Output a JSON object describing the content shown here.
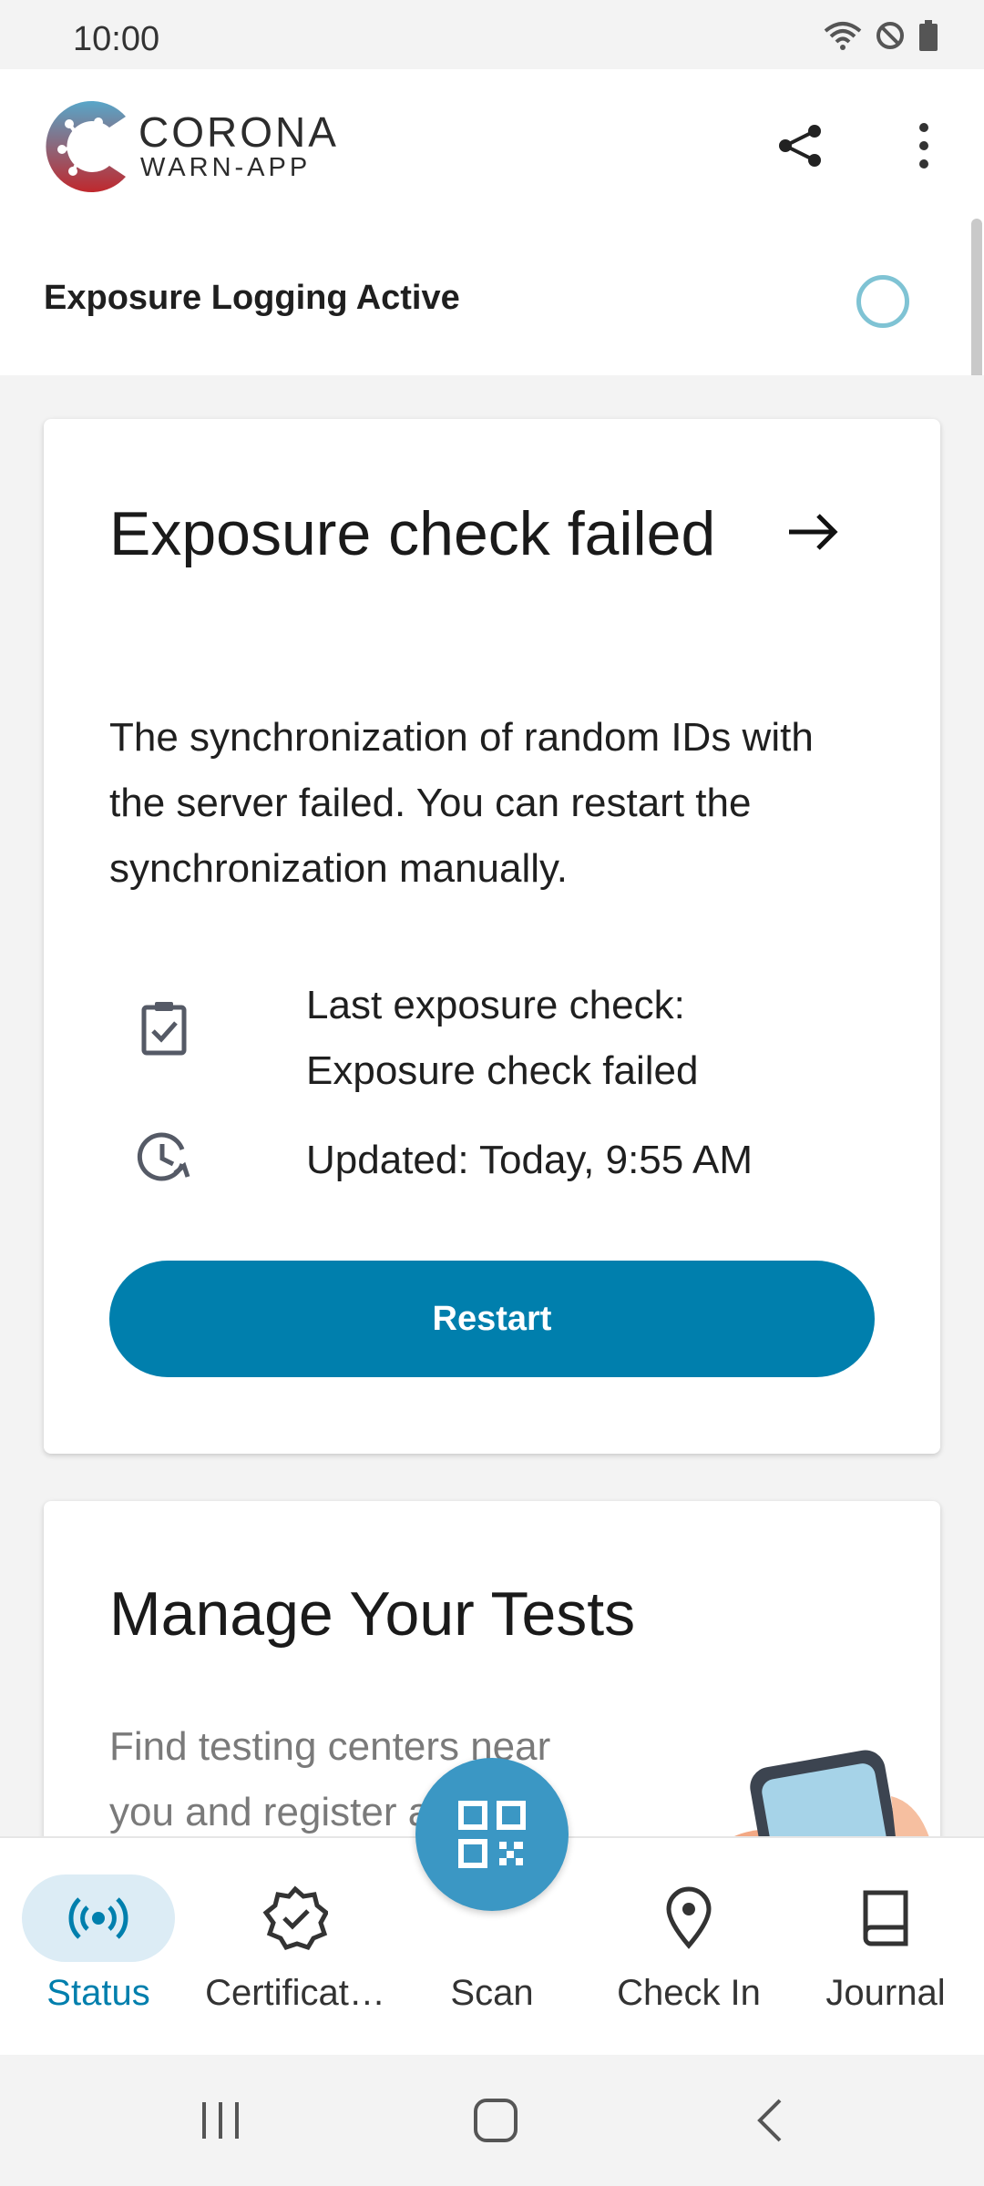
{
  "status_bar": {
    "time": "10:00"
  },
  "app": {
    "brand_line1": "CORONA",
    "brand_line2": "WARN-APP"
  },
  "tracing": {
    "label": "Exposure Logging Active"
  },
  "exposure_card": {
    "title": "Exposure check failed",
    "body": "The synchronization of random IDs with the server failed. You can restart the synchronization manually.",
    "last_check_label": "Last exposure check:",
    "last_check_value": "Exposure check failed",
    "updated": "Updated: Today, 9:55 AM",
    "button": "Restart"
  },
  "tests_card": {
    "title": "Manage Your Tests",
    "description": "Find testing centers near you and register a test."
  },
  "bottom_nav": {
    "items": [
      {
        "label": "Status"
      },
      {
        "label": "Certificat…"
      },
      {
        "label": "Scan"
      },
      {
        "label": "Check In"
      },
      {
        "label": "Journal"
      }
    ],
    "active": "Status"
  },
  "colors": {
    "accent": "#007fad",
    "active_nav": "#007fad",
    "fab": "#3b97c4",
    "tracing_ring": "#7fc3d4"
  }
}
